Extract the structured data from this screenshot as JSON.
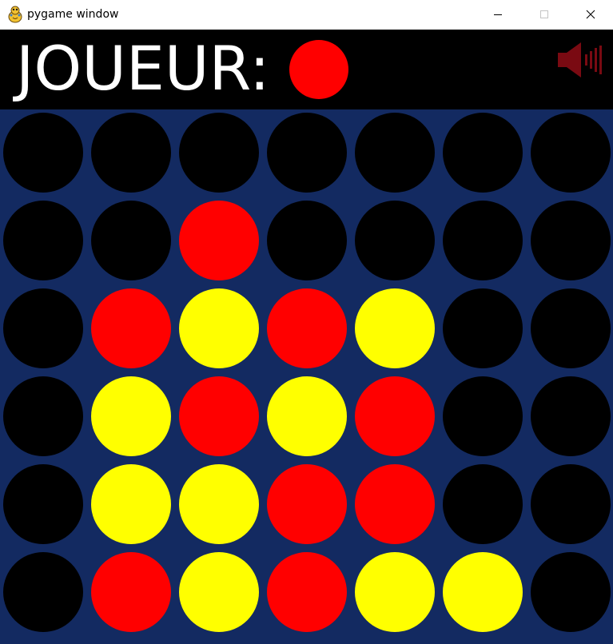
{
  "window": {
    "title": "pygame window"
  },
  "header": {
    "player_label": "JOUEUR:",
    "current_player": "red",
    "sound": "muted"
  },
  "colors": {
    "board": "#132a61",
    "empty": "#000000",
    "red": "#ff0000",
    "yellow": "#ffff00",
    "header_bg": "#000000",
    "sound_icon": "#7a0a12"
  },
  "board": {
    "rows": 6,
    "cols": 7,
    "cells": [
      [
        "empty",
        "empty",
        "empty",
        "empty",
        "empty",
        "empty",
        "empty"
      ],
      [
        "empty",
        "empty",
        "red",
        "empty",
        "empty",
        "empty",
        "empty"
      ],
      [
        "empty",
        "red",
        "yellow",
        "red",
        "yellow",
        "empty",
        "empty"
      ],
      [
        "empty",
        "yellow",
        "red",
        "yellow",
        "red",
        "empty",
        "empty"
      ],
      [
        "empty",
        "yellow",
        "yellow",
        "red",
        "red",
        "empty",
        "empty"
      ],
      [
        "empty",
        "red",
        "yellow",
        "red",
        "yellow",
        "yellow",
        "empty"
      ]
    ]
  }
}
